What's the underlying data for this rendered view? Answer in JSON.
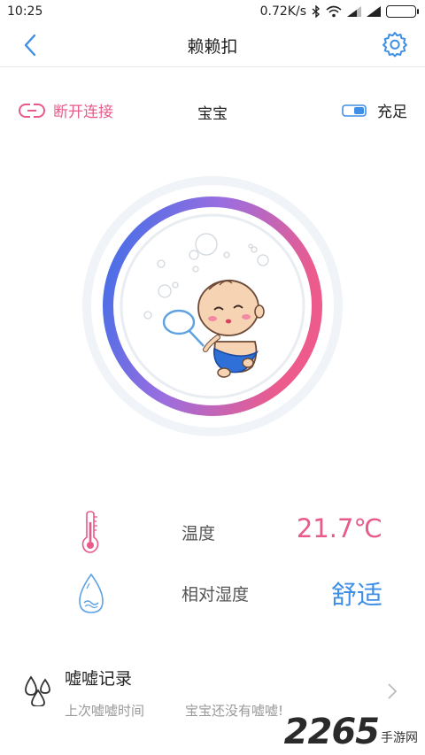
{
  "status_bar": {
    "time": "10:25",
    "network_speed": "0.72K/s",
    "icons": [
      "bluetooth-icon",
      "wifi-icon",
      "signal-icon",
      "signal-icon",
      "battery-icon"
    ]
  },
  "nav": {
    "title": "赖赖扣",
    "back_icon": "chevron-left-icon",
    "settings_icon": "gear-icon"
  },
  "device": {
    "disconnect_label": "断开连接",
    "baby_name": "宝宝",
    "battery_label": "充足"
  },
  "metrics": {
    "temperature": {
      "label": "温度",
      "value": "21.7℃",
      "icon": "thermometer-icon"
    },
    "humidity": {
      "label": "相对湿度",
      "value": "舒适",
      "icon": "water-drop-icon"
    }
  },
  "record": {
    "title": "嘘嘘记录",
    "last_label": "上次嘘嘘时间",
    "last_value": "宝宝还没有嘘嘘!",
    "icon": "water-drops-icon"
  },
  "watermark": {
    "number": "2265",
    "text": "手游网"
  },
  "colors": {
    "accent_blue": "#3f8fe6",
    "accent_pink": "#e85a8a",
    "gauge_blue": "#3b6fe8",
    "gauge_pink": "#ec5b8c"
  }
}
